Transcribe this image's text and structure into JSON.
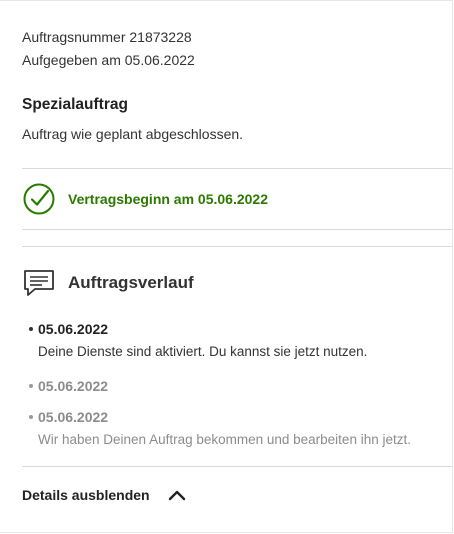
{
  "order": {
    "number": "Auftragsnummer 21873228",
    "placed": "Aufgegeben am 05.06.2022"
  },
  "special": {
    "title": "Spezialauftrag",
    "status": "Auftrag wie geplant abgeschlossen."
  },
  "contract": {
    "text": "Vertragsbeginn am 05.06.2022",
    "icon": "check-circle-icon",
    "color": "#2b7a00"
  },
  "history": {
    "title": "Auftragsverlauf",
    "icon": "chat-bubble-icon",
    "items": [
      {
        "date": "05.06.2022",
        "desc": "Deine Dienste sind aktiviert. Du kannst sie jetzt nutzen."
      },
      {
        "date": "05.06.2022",
        "desc": ""
      },
      {
        "date": "05.06.2022",
        "desc": "Wir haben Deinen Auftrag bekommen und bearbeiten ihn jetzt."
      }
    ]
  },
  "details": {
    "label": "Details ausblenden",
    "icon": "chevron-up-icon"
  }
}
